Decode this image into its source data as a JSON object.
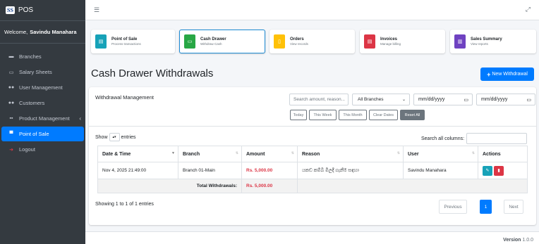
{
  "brand": {
    "logo": "SS",
    "name": "POS"
  },
  "welcome": {
    "prefix": "Welcome,",
    "user": "Savindu Manahara"
  },
  "sidebar": {
    "items": [
      {
        "label": "Branches",
        "icon": "store-icon"
      },
      {
        "label": "Salary Sheets",
        "icon": "money-icon"
      },
      {
        "label": "User Management",
        "icon": "users-cog-icon"
      },
      {
        "label": "Customers",
        "icon": "users-icon"
      },
      {
        "label": "Product Management",
        "icon": "boxes-icon"
      },
      {
        "label": "Point of Sale",
        "icon": "cash-register-icon"
      },
      {
        "label": "Logout",
        "icon": "sign-out-icon"
      }
    ]
  },
  "shortcuts": [
    {
      "title": "Point of Sale",
      "sub": "Process transactions",
      "color": "#17a2b8"
    },
    {
      "title": "Cash Drawer",
      "sub": "Withdraw Cash",
      "color": "#28a745"
    },
    {
      "title": "Orders",
      "sub": "View records",
      "color": "#ffc107"
    },
    {
      "title": "Invoices",
      "sub": "Manage billing",
      "color": "#dc3545"
    },
    {
      "title": "Sales Summary",
      "sub": "View reports",
      "color": "#6f42c1"
    }
  ],
  "page": {
    "title": "Cash Drawer Withdrawals",
    "new_button": "New Withdrawal"
  },
  "filters": {
    "header": "Withdrawal Management",
    "search_placeholder": "Search amount, reason...",
    "branch": "All Branches",
    "date_from": "mm/dd/yyyy",
    "date_to": "mm/dd/yyyy",
    "ranges": [
      "Today",
      "This Week",
      "This Month",
      "Clear Dates",
      "Reset All"
    ]
  },
  "table_controls": {
    "show": "Show",
    "entries": "entries",
    "search_label": "Search all columns:"
  },
  "table": {
    "headers": [
      "Date & Time",
      "Branch",
      "Amount",
      "Reason",
      "User",
      "Actions"
    ],
    "rows": [
      {
        "datetime": "Nov 4, 2025 21:49:00",
        "branch": "Branch 01-Main",
        "amount": "Rs. 5,000.00",
        "reason": "යකඩ කම්බි මිලදී ගැනීම සඳහා",
        "user": "Savindu Manahara"
      }
    ],
    "total_label": "Total Withdrawals:",
    "total_amount": "Rs. 5,000.00"
  },
  "info": "Showing 1 to 1 of 1 entries",
  "pager": {
    "prev": "Previous",
    "page": "1",
    "next": "Next"
  },
  "footer": {
    "version_label": "Version",
    "version": "1.0.0"
  }
}
